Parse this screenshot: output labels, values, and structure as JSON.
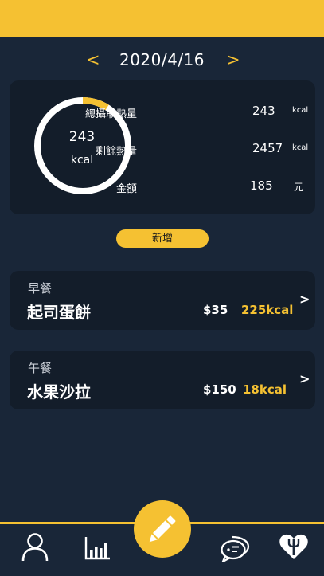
{
  "date_nav": {
    "prev": "<",
    "date": "2020/4/16",
    "next": ">"
  },
  "summary": {
    "ring_value": "243",
    "ring_unit": "kcal",
    "progress_fraction": 0.09,
    "stats": [
      {
        "label": "總攝取熱量",
        "value": "243",
        "unit": "kcal"
      },
      {
        "label": "剩餘熱量",
        "value": "2457",
        "unit": "kcal"
      },
      {
        "label": "金額",
        "value": "185",
        "unit": "元"
      }
    ]
  },
  "add_button": {
    "label": "新增"
  },
  "meals": [
    {
      "type": "早餐",
      "name": "起司蛋餅",
      "price": "$35",
      "kcal": "225kcal",
      "arrow": ">"
    },
    {
      "type": "午餐",
      "name": "水果沙拉",
      "price": "$150",
      "kcal": "18kcal",
      "arrow": ">"
    }
  ],
  "bottom_nav": {
    "icons": [
      "profile-icon",
      "bar-chart-icon",
      "pencil-icon",
      "chat-icon",
      "heart-fork-icon"
    ]
  },
  "colors": {
    "accent": "#F5C132",
    "background": "#192638",
    "card": "#131D2A"
  }
}
